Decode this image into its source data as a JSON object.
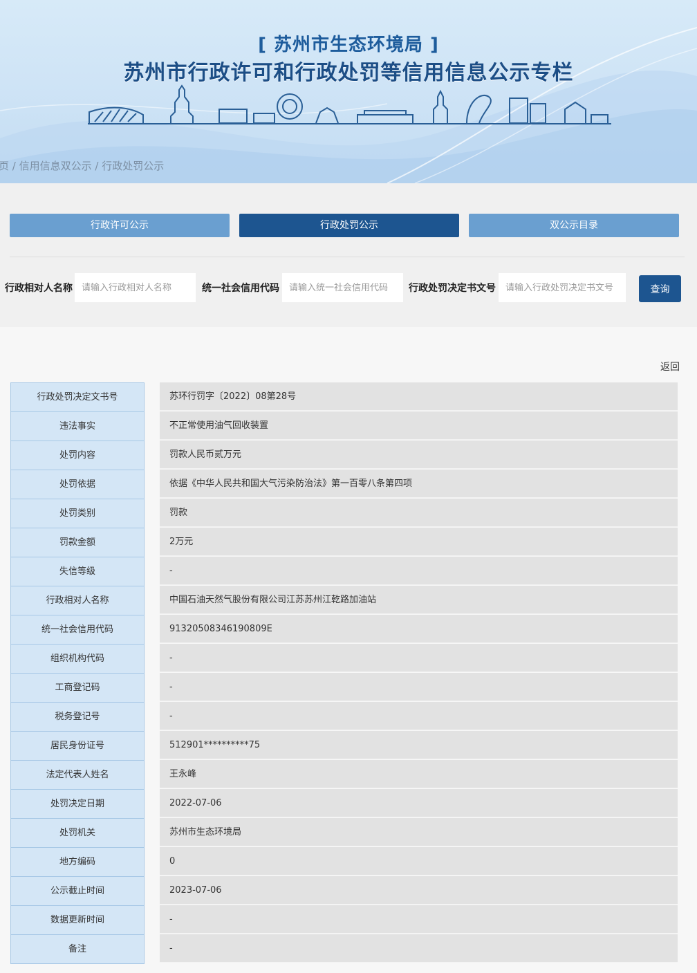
{
  "header": {
    "agency": "[ 苏州市生态环境局 ]",
    "portal_title": "苏州市行政许可和行政处罚等信用信息公示专栏",
    "breadcrumb": [
      "页",
      "信用信息双公示",
      "行政处罚公示"
    ],
    "breadcrumb_separator": " / "
  },
  "nav": {
    "tabs": [
      {
        "label": "行政许可公示",
        "active": false
      },
      {
        "label": "行政处罚公示",
        "active": true
      },
      {
        "label": "双公示目录",
        "active": false
      }
    ]
  },
  "search": {
    "fields": [
      {
        "label": "行政相对人名称",
        "placeholder": "请输入行政相对人名称",
        "value": ""
      },
      {
        "label": "统一社会信用代码",
        "placeholder": "请输入统一社会信用代码",
        "value": ""
      },
      {
        "label": "行政处罚决定书文号",
        "placeholder": "请输入行政处罚决定书文号",
        "value": ""
      }
    ],
    "button_label": "查询"
  },
  "detail": {
    "back_label": "返回",
    "rows": [
      {
        "label": "行政处罚决定文书号",
        "value": "苏环行罚字〔2022〕08第28号"
      },
      {
        "label": "违法事实",
        "value": "不正常使用油气回收装置"
      },
      {
        "label": "处罚内容",
        "value": "罚款人民币贰万元"
      },
      {
        "label": "处罚依据",
        "value": "依据《中华人民共和国大气污染防治法》第一百零八条第四项"
      },
      {
        "label": "处罚类别",
        "value": "罚款"
      },
      {
        "label": "罚款金额",
        "value": "2万元"
      },
      {
        "label": "失信等级",
        "value": "-"
      },
      {
        "label": "行政相对人名称",
        "value": "中国石油天然气股份有限公司江苏苏州江乾路加油站"
      },
      {
        "label": "统一社会信用代码",
        "value": "91320508346190809E"
      },
      {
        "label": "组织机构代码",
        "value": "-"
      },
      {
        "label": "工商登记码",
        "value": "-"
      },
      {
        "label": "税务登记号",
        "value": "-"
      },
      {
        "label": "居民身份证号",
        "value": "512901**********75"
      },
      {
        "label": "法定代表人姓名",
        "value": "王永峰"
      },
      {
        "label": "处罚决定日期",
        "value": "2022-07-06"
      },
      {
        "label": "处罚机关",
        "value": "苏州市生态环境局"
      },
      {
        "label": "地方编码",
        "value": "0"
      },
      {
        "label": "公示截止时间",
        "value": "2023-07-06"
      },
      {
        "label": "数据更新时间",
        "value": "-"
      },
      {
        "label": "备注",
        "value": "-"
      }
    ]
  },
  "colors": {
    "primary": "#1d5590",
    "tab_light": "#6a9fd0",
    "label_bg": "#d4e6f6",
    "value_bg": "#e2e2e2"
  }
}
